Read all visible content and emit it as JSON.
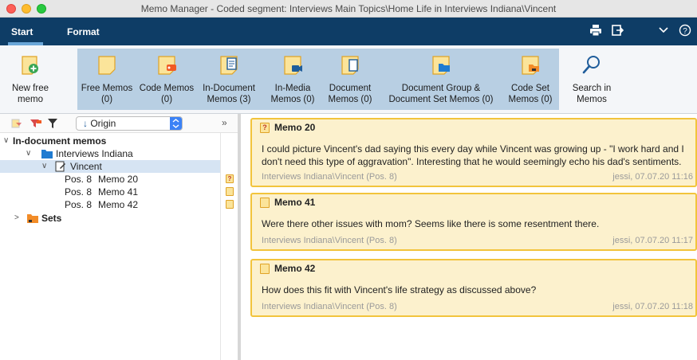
{
  "window": {
    "title": "Memo Manager - Coded segment: Interviews Main Topics\\Home Life in Interviews Indiana\\Vincent"
  },
  "tabs": [
    {
      "label": "Start"
    },
    {
      "label": "Format"
    }
  ],
  "ribbon": {
    "new_free_memo": "New free\nmemo",
    "free_memos": {
      "label": "Free Memos",
      "count": "(0)"
    },
    "code_memos": {
      "label": "Code Memos",
      "count": "(0)"
    },
    "in_document_memos": {
      "label": "In-Document",
      "count": "Memos (3)"
    },
    "in_media_memos": {
      "label": "In-Media",
      "count": "Memos (0)"
    },
    "document_memos": {
      "label": "Document",
      "count": "Memos (0)"
    },
    "doc_group_memos": {
      "label": "Document Group &",
      "count": "Document Set Memos (0)"
    },
    "code_set_memos": {
      "label": "Code Set",
      "count": "Memos (0)"
    },
    "search_memos": {
      "label": "Search in",
      "count": "Memos"
    }
  },
  "left": {
    "sort_select": "Origin",
    "tree": {
      "root": "In-document memos",
      "group": "Interviews Indiana",
      "document": "Vincent",
      "memos": [
        {
          "pos": "Pos. 8",
          "name": "Memo 20"
        },
        {
          "pos": "Pos. 8",
          "name": "Memo 41"
        },
        {
          "pos": "Pos. 8",
          "name": "Memo 42"
        }
      ],
      "sets": "Sets"
    }
  },
  "memos": [
    {
      "title": "Memo 20",
      "text": "I could picture Vincent's dad saying this every day while Vincent was growing up - \"I work hard and I don't need this type of aggravation\". Interesting that he would seemingly echo his dad's sentiments.",
      "source": "Interviews Indiana\\Vincent (Pos. 8)",
      "meta": "jessi, 07.07.20 11:16"
    },
    {
      "title": "Memo 41",
      "text": "Were there other issues with mom? Seems like there is some resentment there.",
      "source": "Interviews Indiana\\Vincent (Pos. 8)",
      "meta": "jessi, 07.07.20 11:17"
    },
    {
      "title": "Memo 42",
      "text": "How does this fit with Vincent's life strategy as discussed above?",
      "source": "Interviews Indiana\\Vincent (Pos. 8)",
      "meta": "jessi, 07.07.20 11:18"
    }
  ],
  "colors": {
    "tabbar": "#0e3d66",
    "ribbon_group": "#b8cfe3",
    "memo_bg": "#fcf1cd",
    "memo_border": "#f2c43c"
  }
}
